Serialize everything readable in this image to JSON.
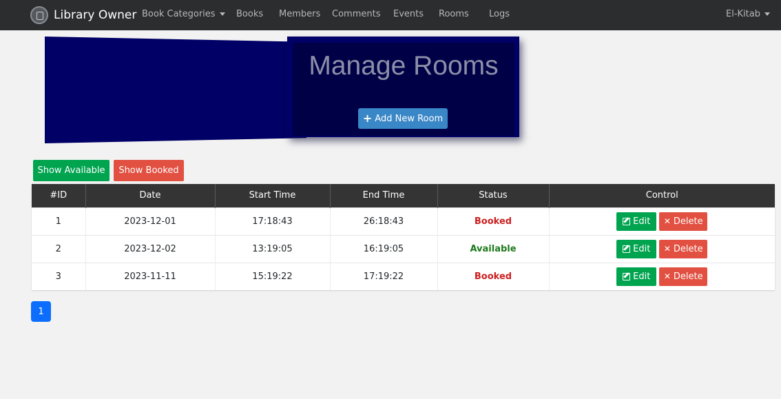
{
  "navbar": {
    "brand": "Library Owner",
    "items": [
      {
        "label": "Book Categories",
        "dropdown": true
      },
      {
        "label": "Books"
      },
      {
        "label": "Members"
      },
      {
        "label": "Comments"
      },
      {
        "label": "Events"
      },
      {
        "label": "Rooms"
      },
      {
        "label": "Logs"
      }
    ],
    "user": "El-Kitab"
  },
  "hero": {
    "title": "Manage Rooms",
    "add_button": "Add New Room"
  },
  "filters": {
    "available": "Show Available",
    "booked": "Show Booked"
  },
  "table": {
    "headers": [
      "#ID",
      "Date",
      "Start Time",
      "End Time",
      "Status",
      "Control"
    ],
    "rows": [
      {
        "id": "1",
        "date": "2023-12-01",
        "start": "17:18:43",
        "end": "26:18:43",
        "status": "Booked"
      },
      {
        "id": "2",
        "date": "2023-12-02",
        "start": "13:19:05",
        "end": "16:19:05",
        "status": "Available"
      },
      {
        "id": "3",
        "date": "2023-11-11",
        "start": "15:19:22",
        "end": "17:19:22",
        "status": "Booked"
      }
    ],
    "edit_label": "Edit",
    "delete_label": "Delete"
  },
  "pagination": {
    "current": "1"
  },
  "colors": {
    "navbar": "#2b2d2f",
    "hero": "#000066",
    "success": "#00a44f",
    "danger": "#e25041",
    "primary": "#0d6efd",
    "info": "#3a87c7"
  },
  "icons": {
    "brand": "library-logo-icon",
    "add": "plus-icon",
    "edit": "edit-icon",
    "delete": "x-icon",
    "dropdown": "caret-down-icon"
  }
}
